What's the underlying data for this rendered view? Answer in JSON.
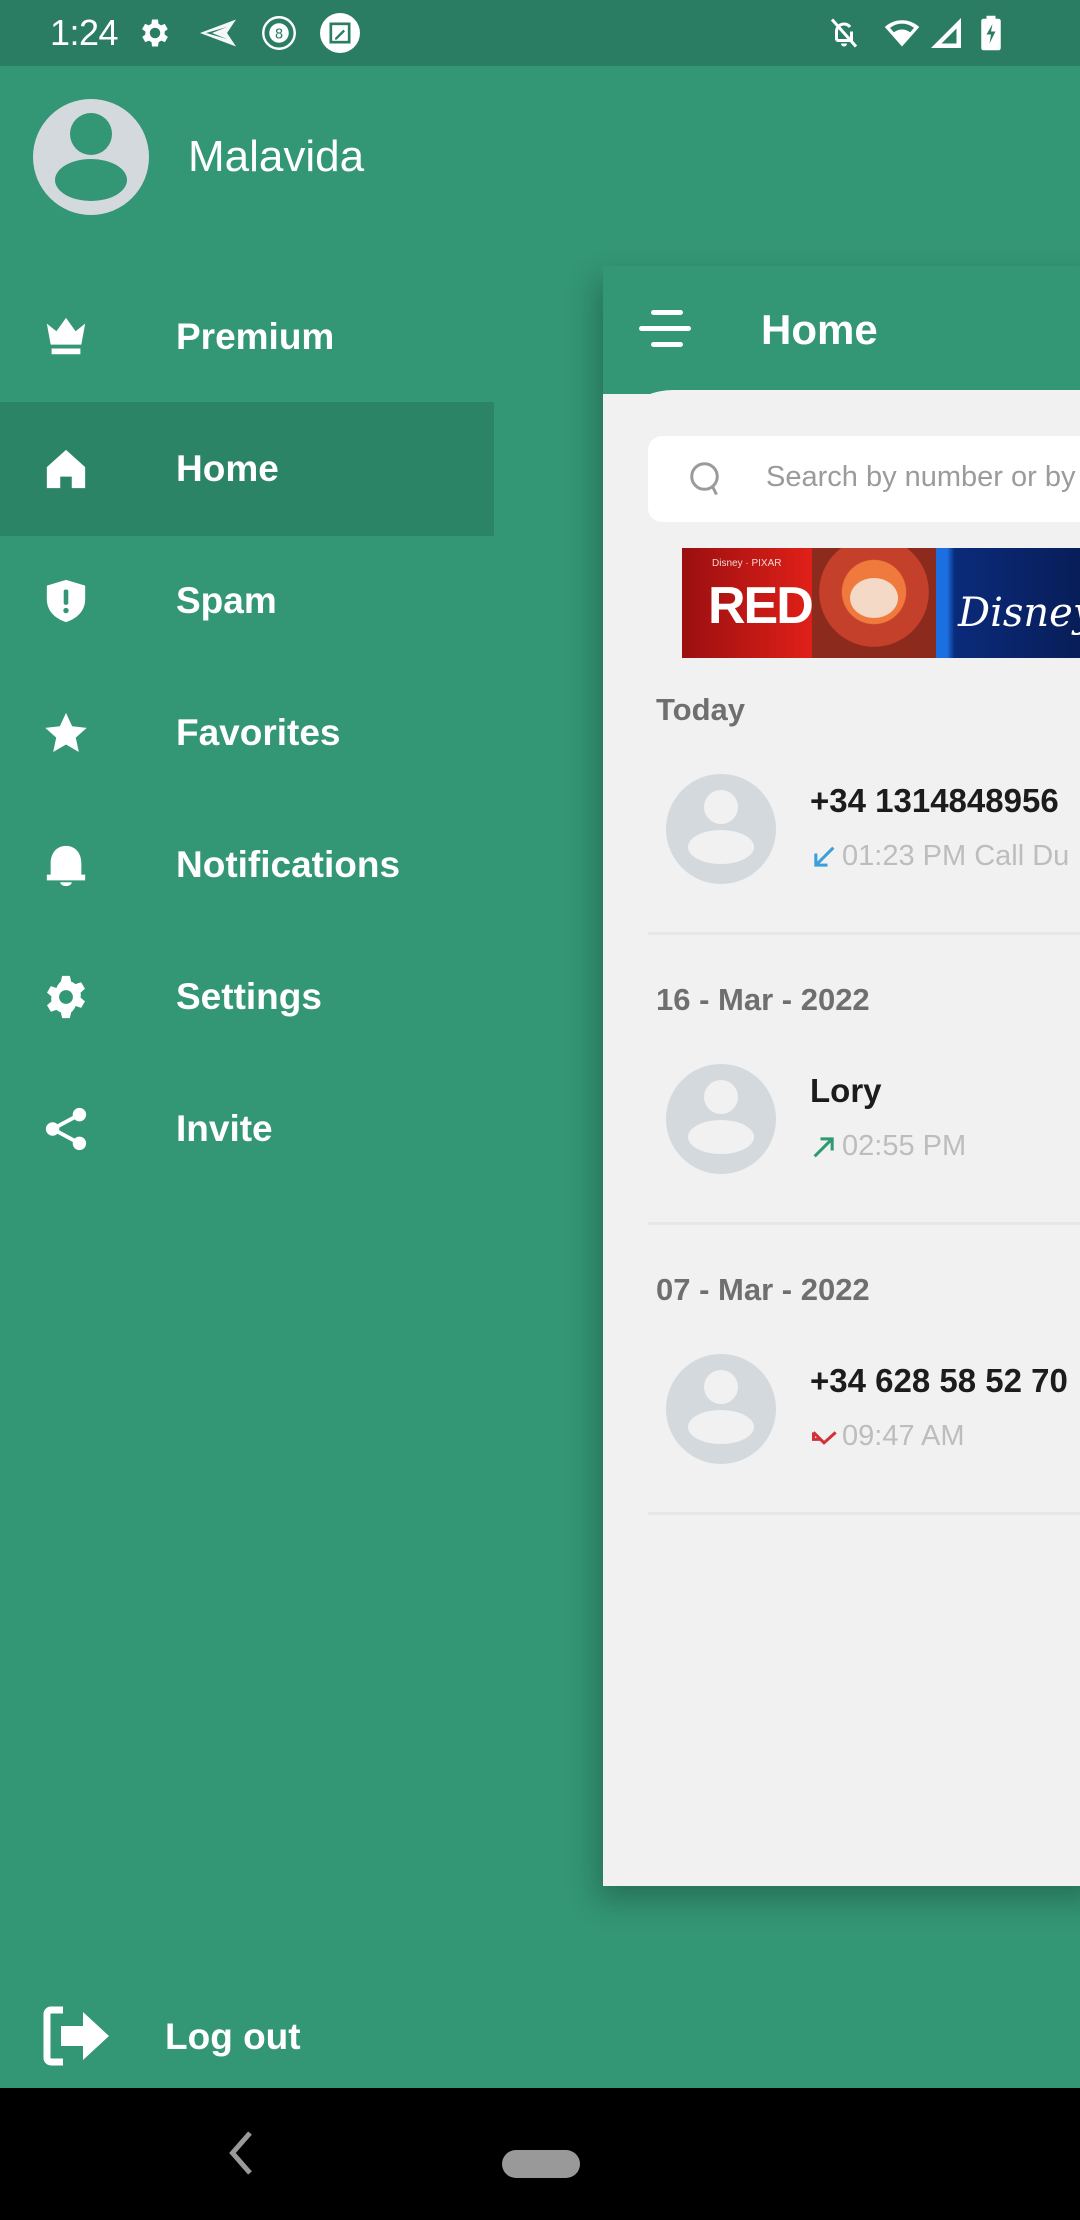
{
  "status_bar": {
    "time": "1:24",
    "left_icons": [
      "settings-icon",
      "send-icon",
      "8-ball-icon",
      "screenshot-edit-icon"
    ],
    "right_icons": [
      "notifications-off-icon",
      "wifi-icon",
      "signal-icon",
      "battery-charging-icon"
    ]
  },
  "drawer": {
    "profile": {
      "name": "Malavida",
      "avatar_icon": "person-icon"
    },
    "items": [
      {
        "label": "Premium",
        "icon": "crown-icon",
        "active": false
      },
      {
        "label": "Home",
        "icon": "home-icon",
        "active": true
      },
      {
        "label": "Spam",
        "icon": "shield-alert-icon",
        "active": false
      },
      {
        "label": "Favorites",
        "icon": "star-icon",
        "active": false
      },
      {
        "label": "Notifications",
        "icon": "bell-icon",
        "active": false
      },
      {
        "label": "Settings",
        "icon": "gear-icon",
        "active": false
      },
      {
        "label": "Invite",
        "icon": "share-icon",
        "active": false
      }
    ],
    "logout": {
      "label": "Log out",
      "icon": "logout-icon"
    }
  },
  "home": {
    "title": "Home",
    "search": {
      "placeholder": "Search by number or by name",
      "value": ""
    },
    "ad": {
      "brand": "Disney · PIXAR",
      "title": "RED",
      "partner": "Disney"
    },
    "sections": [
      {
        "label": "Today",
        "calls": [
          {
            "name": "+34 1314848956",
            "time": "01:23 PM",
            "extra": "Call Du",
            "direction": "incoming",
            "direction_color": "#3aa0dc"
          }
        ]
      },
      {
        "label": "16 - Mar - 2022",
        "calls": [
          {
            "name": "Lory",
            "time": "02:55 PM",
            "extra": "",
            "direction": "outgoing",
            "direction_color": "#2e9a6f"
          }
        ]
      },
      {
        "label": "07 - Mar - 2022",
        "calls": [
          {
            "name": "+34 628 58 52 70",
            "time": "09:47 AM",
            "extra": "",
            "direction": "missed",
            "direction_color": "#d2313a"
          }
        ]
      }
    ]
  },
  "colors": {
    "primary": "#339675",
    "primary_dark": "#2a7d63",
    "active_item": "#2b8465",
    "surface": "#f1f1f1"
  }
}
